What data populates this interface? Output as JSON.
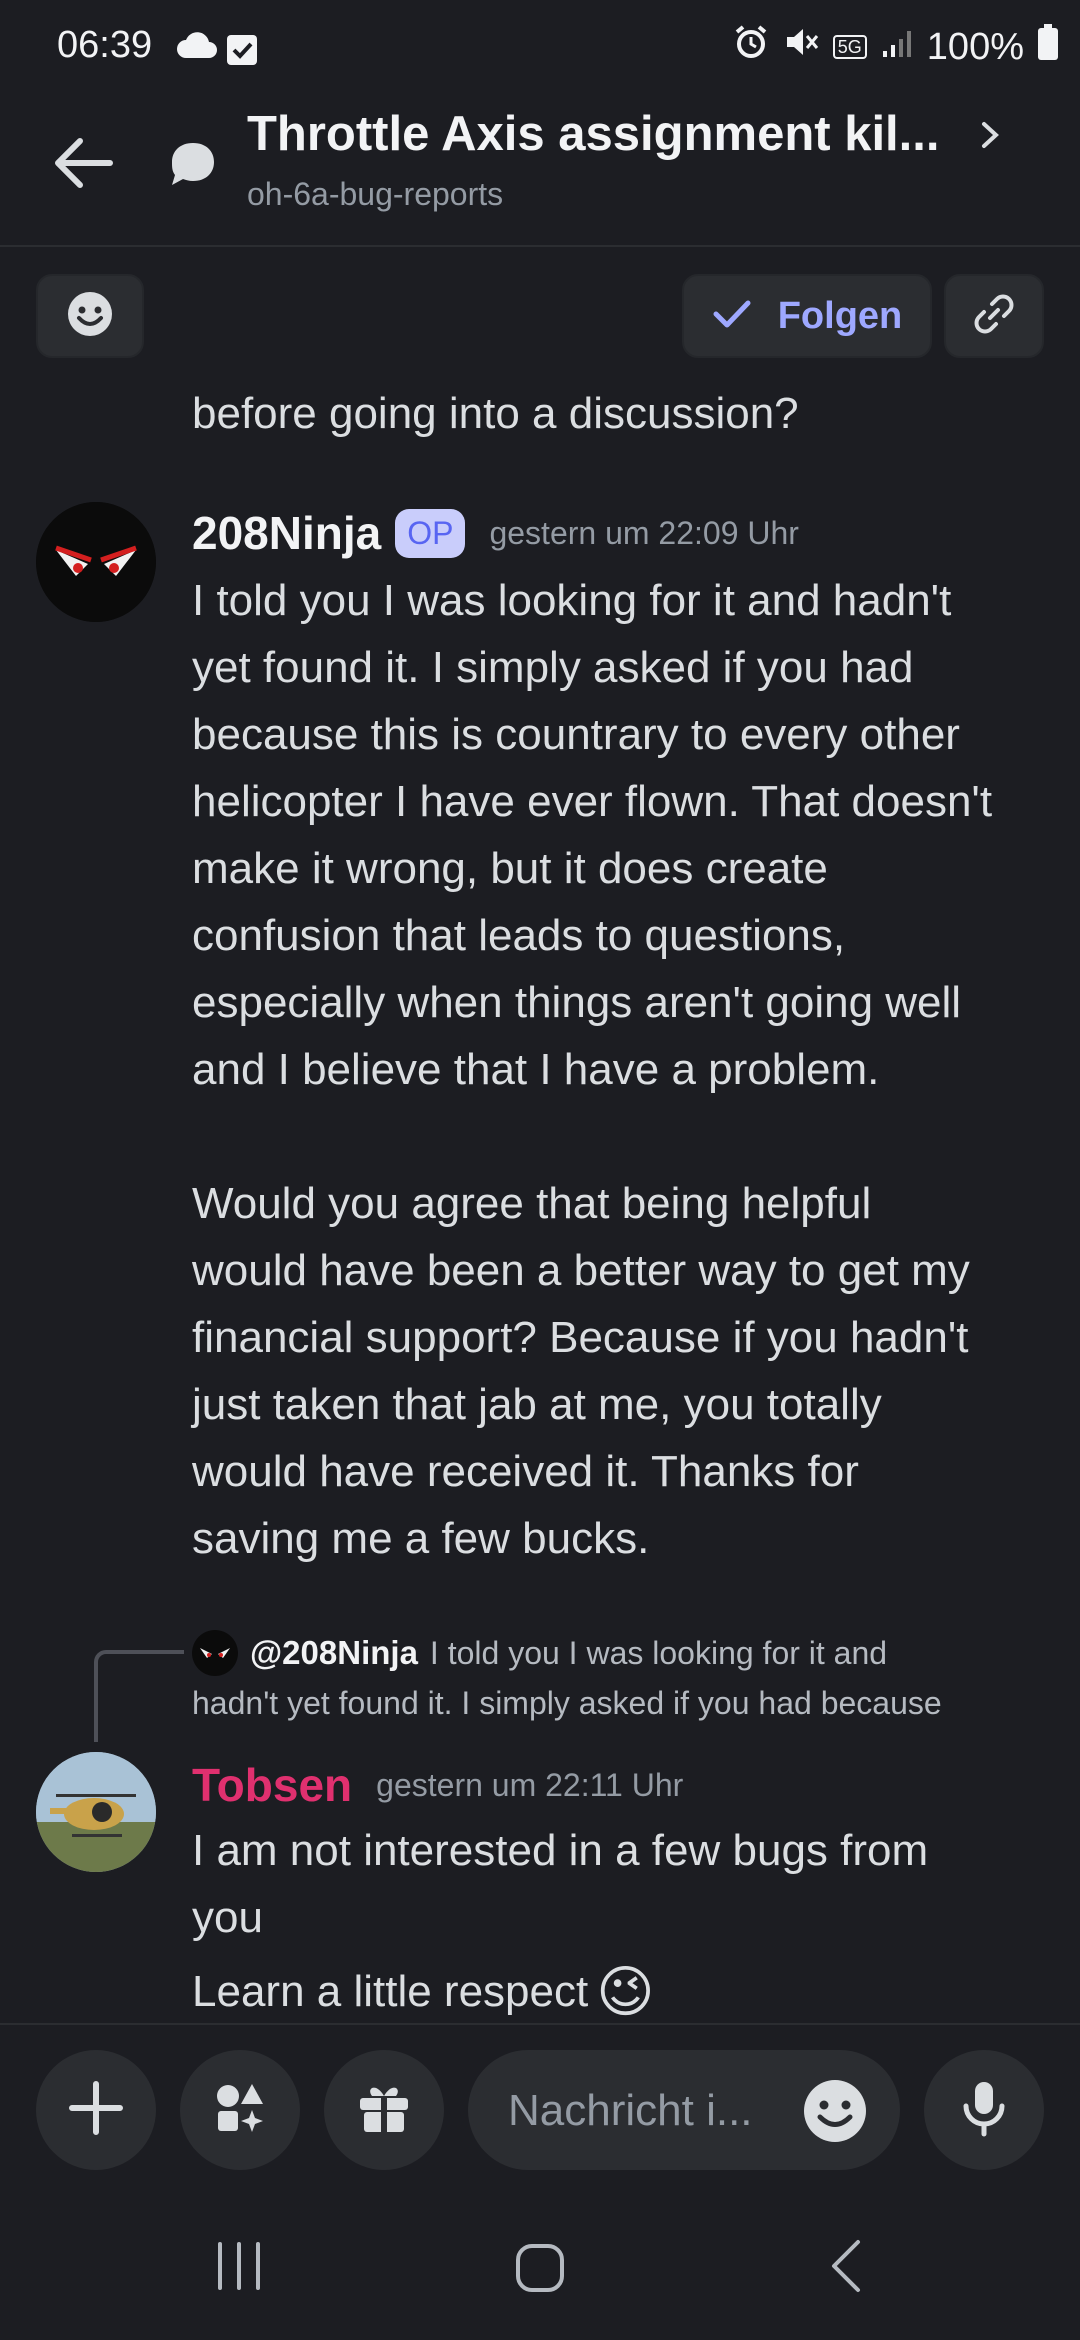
{
  "status_bar": {
    "time": "06:39",
    "battery": "100%",
    "network": "5G"
  },
  "header": {
    "title": "Throttle Axis assignment kil...",
    "channel": "oh-6a-bug-reports"
  },
  "actions": {
    "follow_label": "Folgen"
  },
  "messages": {
    "truncated_tail": "before going into a discussion?",
    "m1": {
      "author": "208Ninja",
      "badge": "OP",
      "timestamp": "gestern um 22:09 Uhr",
      "para1": [
        "I told you I was looking for it and hadn't",
        "yet found it. I simply asked if you had",
        "because this is countrary to every other",
        "helicopter I have ever flown. That doesn't",
        "make it wrong, but it does create",
        "confusion that leads to questions,",
        "especially when things aren't going well",
        "and I believe that I have a problem."
      ],
      "para2": [
        "Would you agree that being helpful",
        "would have been a better way to get my",
        "financial support? Because if you hadn't",
        "just taken that jab at me, you totally",
        "would have received it.  Thanks for",
        "saving me a few bucks."
      ]
    },
    "reply_preview": {
      "mention": "@208Ninja",
      "line1": "I told you I was looking for it and",
      "line2": "hadn't yet found it. I simply asked if you had because"
    },
    "m2": {
      "author": "Tobsen",
      "timestamp": "gestern um 22:11 Uhr",
      "line1": "I am not interested in a few bugs from",
      "line2": "you",
      "line3": "Learn a little respect",
      "emoji": "😉"
    }
  },
  "composer": {
    "placeholder": "Nachricht i..."
  },
  "colors": {
    "background": "#1c1d22",
    "accent": "#9ea8ff",
    "tobsen_name": "#e0306f"
  },
  "icons": [
    "cloud-icon",
    "checkbox-icon",
    "alarm-icon",
    "mute-icon",
    "signal-icon",
    "battery-icon",
    "back-arrow-icon",
    "thread-icon",
    "chevron-right-icon",
    "emoji-icon",
    "check-icon",
    "link-icon",
    "plus-icon",
    "apps-icon",
    "gift-icon",
    "mic-icon"
  ]
}
